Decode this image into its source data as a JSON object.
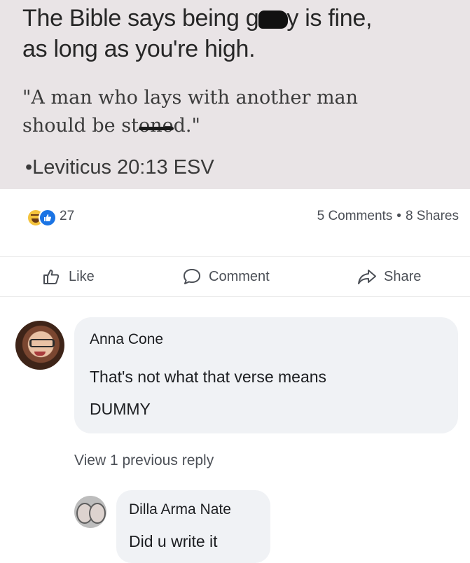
{
  "meme": {
    "headline_before": "The Bible says being g",
    "headline_after": "y is fine,",
    "headline_line2": "as long as you're high.",
    "quote_line1": "\"A man who lays with another man",
    "quote_line2_start": "should be st",
    "quote_line2_struck": "one",
    "quote_line2_end": "d.\"",
    "reference": "•Leviticus 20:13 ESV"
  },
  "post_stats": {
    "reaction_icons": [
      "haha-icon",
      "like-icon"
    ],
    "reaction_count": "27",
    "comments_count": "5 Comments",
    "separator": "•",
    "shares_count": "8 Shares"
  },
  "actions": {
    "like_label": "Like",
    "comment_label": "Comment",
    "share_label": "Share"
  },
  "comments": [
    {
      "author": "Anna Cone",
      "text": "That's not what that verse means\nDUMMY"
    }
  ],
  "view_replies_label": "View 1 previous reply",
  "reply": {
    "author": "Dilla Arma Nate",
    "text": "Did u write it"
  },
  "colors": {
    "meme_bg": "#e9e4e6",
    "bubble_bg": "#f0f2f5",
    "like_blue": "#1b74e4",
    "haha_yellow": "#f4c33c",
    "secondary_text": "#4b4f56"
  }
}
